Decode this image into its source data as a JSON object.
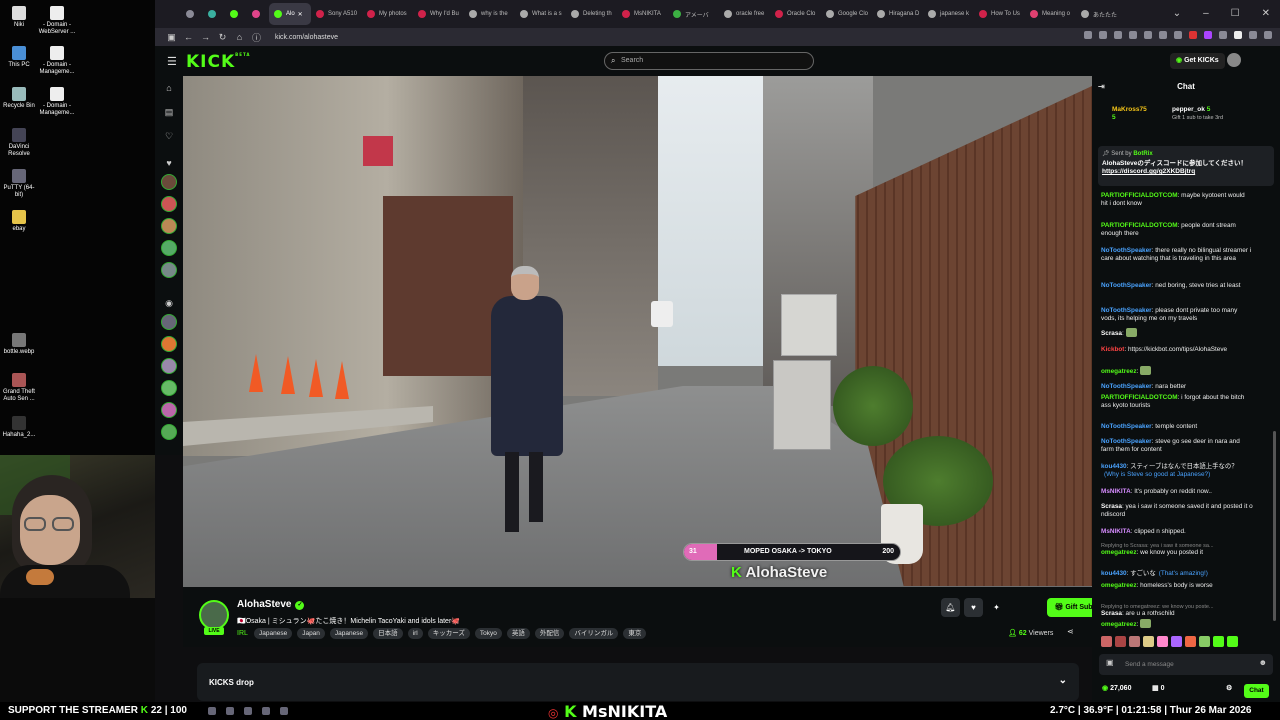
{
  "desktop": {
    "icons": [
      {
        "label": "Niki"
      },
      {
        "label": "- Domain - WebServer ..."
      },
      {
        "label": "This PC"
      },
      {
        "label": "- Domain - Manageme..."
      },
      {
        "label": "Recycle Bin"
      },
      {
        "label": "- Domain - Manageme..."
      },
      {
        "label": "DaVinci Resolve"
      },
      {
        "label": "PuTTY (64-bit)"
      },
      {
        "label": "ebay"
      },
      {
        "label": "bottle.webp"
      },
      {
        "label": "Grand Theft Auto Sen ..."
      },
      {
        "label": "Hahaha_2..."
      }
    ]
  },
  "browser": {
    "tabs": [
      {
        "label": "",
        "color": "#8a8a96"
      },
      {
        "label": "",
        "color": "#3ab0a0"
      },
      {
        "label": "",
        "color": "#53fc18"
      },
      {
        "label": "",
        "color": "#e0448a"
      },
      {
        "label": "Alo",
        "color": "#53fc18",
        "active": true
      },
      {
        "label": "Sony A510",
        "color": "#d0224a"
      },
      {
        "label": "My photos",
        "color": "#d0224a"
      },
      {
        "label": "Why I'd Bu",
        "color": "#d0224a"
      },
      {
        "label": "why is the",
        "color": "#aaaaaa"
      },
      {
        "label": "What is a s",
        "color": "#aaaaaa"
      },
      {
        "label": "Deleting th",
        "color": "#aaaaaa"
      },
      {
        "label": "MsNIKITA",
        "color": "#d0224a"
      },
      {
        "label": "アメーバ",
        "color": "#3cb043"
      },
      {
        "label": "oracle free",
        "color": "#aaaaaa"
      },
      {
        "label": "Oracle Clo",
        "color": "#d0224a"
      },
      {
        "label": "Google Clo",
        "color": "#aaaaaa"
      },
      {
        "label": "Hiragana D",
        "color": "#aaaaaa"
      },
      {
        "label": "japanese k",
        "color": "#aaaaaa"
      },
      {
        "label": "How To Us",
        "color": "#d0224a"
      },
      {
        "label": "Meaning o",
        "color": "#e04070"
      },
      {
        "label": "あたたた",
        "color": "#aaaaaa"
      }
    ],
    "url": "kick.com/alohasteve"
  },
  "kick": {
    "logo": "KICK",
    "logo_beta": "BETA",
    "search_placeholder": "Search",
    "get_kicks": "Get KICKs",
    "goal": {
      "current": "31",
      "label": "MOPED OSAKA -> TOKYO",
      "target": "200",
      "progress": 0.155
    },
    "watermark": "AlohaSteve",
    "streamer": {
      "name": "AlohaSteve",
      "live": "LIVE",
      "title": "🇯🇵Osaka | ミシュラン🐙たこ焼き！Michelin TacoYaki and idols later🐙",
      "category": "IRL",
      "tags": [
        "Japanese",
        "Japan",
        "Japanese",
        "日本語",
        "irl",
        "キッカーズ",
        "Tokyo",
        "英語",
        "外配信",
        "バイリンガル",
        "東京"
      ],
      "gift_subs": "Gift Subs",
      "viewers": "62",
      "viewers_label": "Viewers"
    },
    "kicks_drop": "KICKS drop"
  },
  "chat": {
    "title": "Chat",
    "gifters": [
      {
        "name": "MaKross75",
        "count": "5",
        "color": "#f5c518"
      },
      {
        "name": "pepper_ok",
        "count": "5",
        "color": "#ffffff",
        "sub": "Gift 1 sub to take 3rd"
      }
    ],
    "pinned": {
      "by": "Sent by",
      "user": "BotRix",
      "text": "AlohaSteveのディスコードに参加してください！",
      "link": "https://discord.gg/g2XKDBjtrq"
    },
    "messages": [
      {
        "user": "PARTIOFFICIALDOTCOM",
        "color": "#53fc18",
        "text": "maybe kyotoent would hit i dont know"
      },
      {
        "user": "PARTIOFFICIALDOTCOM",
        "color": "#53fc18",
        "text": "people dont stream enough there"
      },
      {
        "user": "NoToothSpeaker",
        "color": "#4aa3ff",
        "text": "there really no bilingual streamer i care about watching that is traveling in this area"
      },
      {
        "user": "NoToothSpeaker",
        "color": "#4aa3ff",
        "text": "ned boring, steve tries at least"
      },
      {
        "user": "NoToothSpeaker",
        "color": "#4aa3ff",
        "text": "please dont private too many vods, its helping me on my travels"
      },
      {
        "user": "Scrasa",
        "color": "#ffffff",
        "text": ""
      },
      {
        "user": "Kickbot",
        "color": "#ff4444",
        "text": "https://kickbot.com/tips/AlohaSteve"
      },
      {
        "user": "omegatreez",
        "color": "#53fc18",
        "text": ""
      },
      {
        "user": "NoToothSpeaker",
        "color": "#4aa3ff",
        "text": "nara better"
      },
      {
        "user": "PARTIOFFICIALDOTCOM",
        "color": "#53fc18",
        "text": "i forgot about the bitch ass kyoto tourists"
      },
      {
        "user": "NoToothSpeaker",
        "color": "#4aa3ff",
        "text": "temple content"
      },
      {
        "user": "NoToothSpeaker",
        "color": "#4aa3ff",
        "text": "steve go see deer in nara and farm them for content"
      },
      {
        "user": "kou4430",
        "color": "#4aa3ff",
        "text": "スティーブはなんで日本語上手なの？",
        "translation": "(Why is Steve so good at Japanese?)"
      },
      {
        "user": "MsNIKITA",
        "color": "#d68cff",
        "text": "It's probably on reddit now.."
      },
      {
        "user": "Scrasa",
        "color": "#ffffff",
        "text": "yea i saw it someone saved it and posted it o ndiscord"
      },
      {
        "user": "MsNIKITA",
        "color": "#d68cff",
        "text": "clipped n shipped."
      },
      {
        "user": "omegatreez",
        "color": "#53fc18",
        "text": "we know you posted it",
        "reply": "Replying to Scrasa: yea i saw it someone sa..."
      },
      {
        "user": "kou4430",
        "color": "#4aa3ff",
        "text": "すごいな",
        "translation": "(That's amazing!)"
      },
      {
        "user": "omegatreez",
        "color": "#53fc18",
        "text": "homeless's body is worse"
      },
      {
        "user": "Scrasa",
        "color": "#ffffff",
        "text": "are u a rothschild",
        "reply": "Replying to omegatreez: we know you poste..."
      },
      {
        "user": "omegatreez",
        "color": "#53fc18",
        "text": ""
      }
    ],
    "send_placeholder": "Send a message",
    "kicks_balance": "27,060",
    "sub_count": "0",
    "chat_button": "Chat"
  },
  "overlay": {
    "support": "SUPPORT THE STREAMER",
    "support_count": "22",
    "support_target": "100",
    "center_name": "MsNIKITA",
    "status": "2.7°C | 36.9°F | 01:21:58 | Thur 26 Mar 2026"
  }
}
